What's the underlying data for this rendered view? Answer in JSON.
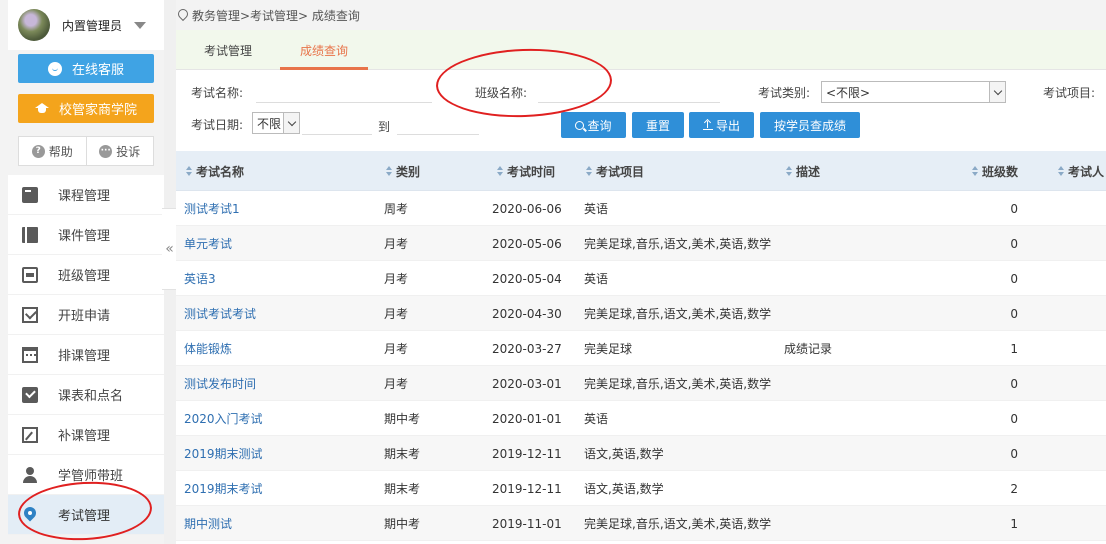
{
  "user": {
    "name": "内置管理员"
  },
  "sidebar": {
    "service_button": "在线客服",
    "academy_button": "校管家商学院",
    "help": "帮助",
    "complaint": "投诉",
    "items": [
      {
        "label": "课程管理"
      },
      {
        "label": "课件管理"
      },
      {
        "label": "班级管理"
      },
      {
        "label": "开班申请"
      },
      {
        "label": "排课管理"
      },
      {
        "label": "课表和点名"
      },
      {
        "label": "补课管理"
      },
      {
        "label": "学管师带班"
      },
      {
        "label": "考试管理"
      }
    ],
    "collapse": "«"
  },
  "breadcrumb": "教务管理>考试管理> 成绩查询",
  "tabs": [
    {
      "label": "考试管理"
    },
    {
      "label": "成绩查询"
    }
  ],
  "filters": {
    "exam_name_label": "考试名称:",
    "class_name_label": "班级名称:",
    "exam_type_label": "考试类别:",
    "exam_type_value": "<不限>",
    "exam_item_label": "考试项目:",
    "exam_date_label": "考试日期:",
    "date_mode_value": "不限",
    "to_label": "到"
  },
  "buttons": {
    "query": "查询",
    "reset": "重置",
    "export": "导出",
    "by_student": "按学员查成绩"
  },
  "table": {
    "headers": {
      "name": "考试名称",
      "type": "类别",
      "time": "考试时间",
      "items": "考试项目",
      "desc": "描述",
      "classes": "班级数",
      "people": "考试人"
    },
    "rows": [
      {
        "name": "测试考试1",
        "type": "周考",
        "time": "2020-06-06",
        "items": "英语",
        "desc": "",
        "classes": "0"
      },
      {
        "name": "单元考试",
        "type": "月考",
        "time": "2020-05-06",
        "items": "完美足球,音乐,语文,美术,英语,数学",
        "desc": "",
        "classes": "0"
      },
      {
        "name": "英语3",
        "type": "月考",
        "time": "2020-05-04",
        "items": "英语",
        "desc": "",
        "classes": "0"
      },
      {
        "name": "测试考试考试",
        "type": "月考",
        "time": "2020-04-30",
        "items": "完美足球,音乐,语文,美术,英语,数学",
        "desc": "",
        "classes": "0"
      },
      {
        "name": "体能锻炼",
        "type": "月考",
        "time": "2020-03-27",
        "items": "完美足球",
        "desc": "成绩记录",
        "classes": "1"
      },
      {
        "name": "测试发布时间",
        "type": "月考",
        "time": "2020-03-01",
        "items": "完美足球,音乐,语文,美术,英语,数学",
        "desc": "",
        "classes": "0"
      },
      {
        "name": "2020入门考试",
        "type": "期中考",
        "time": "2020-01-01",
        "items": "英语",
        "desc": "",
        "classes": "0"
      },
      {
        "name": "2019期末测试",
        "type": "期末考",
        "time": "2019-12-11",
        "items": "语文,英语,数学",
        "desc": "",
        "classes": "0"
      },
      {
        "name": "2019期末考试",
        "type": "期末考",
        "time": "2019-12-11",
        "items": "语文,英语,数学",
        "desc": "",
        "classes": "2"
      },
      {
        "name": "期中测试",
        "type": "期中考",
        "time": "2019-11-01",
        "items": "完美足球,音乐,语文,美术,英语,数学",
        "desc": "",
        "classes": "1"
      }
    ]
  },
  "colors": {
    "primary": "#2f8fd8",
    "accent": "#e8744a",
    "service": "#3fa3e4",
    "academy": "#f4a41c",
    "annotation": "#e02020"
  }
}
